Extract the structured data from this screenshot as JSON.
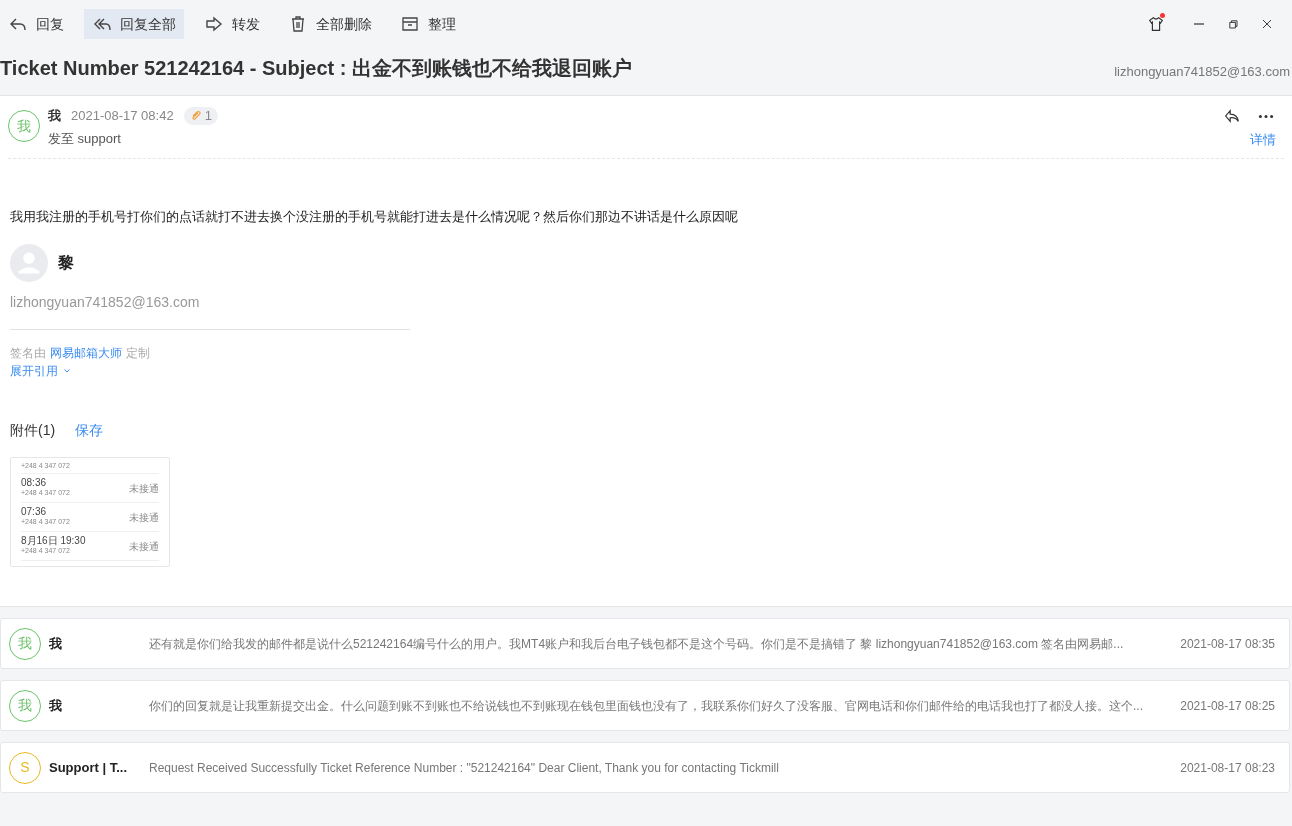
{
  "toolbar": [
    {
      "label": "回复",
      "kind": "reply",
      "selected": false
    },
    {
      "label": "回复全部",
      "kind": "replyall",
      "selected": true
    },
    {
      "label": "转发",
      "kind": "forward",
      "selected": false
    },
    {
      "label": "全部删除",
      "kind": "delete",
      "selected": false
    },
    {
      "label": "整理",
      "kind": "organize",
      "selected": false
    }
  ],
  "window": {
    "skin_notification": true
  },
  "subject": "Ticket Number 521242164 - Subject : 出金不到账钱也不给我退回账户",
  "account": "lizhongyuan741852@163.com",
  "message": {
    "avatar": "我",
    "sender": "我",
    "date": "2021-08-17 08:42",
    "attachment_count": "1",
    "recipient": "发至 support",
    "details": "详情",
    "body": "我用我注册的手机号打你们的点话就打不进去换个没注册的手机号就能打进去是什么情况呢？然后你们那边不讲话是什么原因呢",
    "signature": {
      "name": "黎",
      "email": "lizhongyuan741852@163.com",
      "signed_prefix": "签名由",
      "signed_link": "网易邮箱大师",
      "signed_suffix": "定制"
    },
    "expand_quote": "展开引用",
    "attachments_label": "附件(1)",
    "save": "保存",
    "thumbnail": {
      "rows": [
        {
          "time": "",
          "number": "+248 4 347 072",
          "status": ""
        },
        {
          "time": "08:36",
          "number": "+248 4 347 072",
          "status": "未接通"
        },
        {
          "time": "07:36",
          "number": "+248 4 347 072",
          "status": "未接通"
        },
        {
          "time": "8月16日 19:30",
          "number": "+248 4 347 072",
          "status": "未接通"
        }
      ]
    }
  },
  "thread": [
    {
      "avatar": "我",
      "color": "#6cc36c",
      "sender": "我",
      "preview": "还有就是你们给我发的邮件都是说什么521242164编号什么的用户。我MT4账户和我后台电子钱包都不是这个号码。你们是不是搞错了 黎 lizhongyuan741852@163.com 签名由网易邮...",
      "time": "2021-08-17 08:35"
    },
    {
      "avatar": "我",
      "color": "#6cc36c",
      "sender": "我",
      "preview": "你们的回复就是让我重新提交出金。什么问题到账不到账也不给说钱也不到账现在钱包里面钱也没有了，我联系你们好久了没客服、官网电话和你们邮件给的电话我也打了都没人接。这个...",
      "time": "2021-08-17 08:25"
    },
    {
      "avatar": "S",
      "color": "#e8b923",
      "sender": "Support | T...",
      "preview": "Request Received Successfully Ticket Reference Number : \"521242164\" Dear Client, Thank you for contacting Tickmill",
      "time": "2021-08-17 08:23"
    }
  ]
}
